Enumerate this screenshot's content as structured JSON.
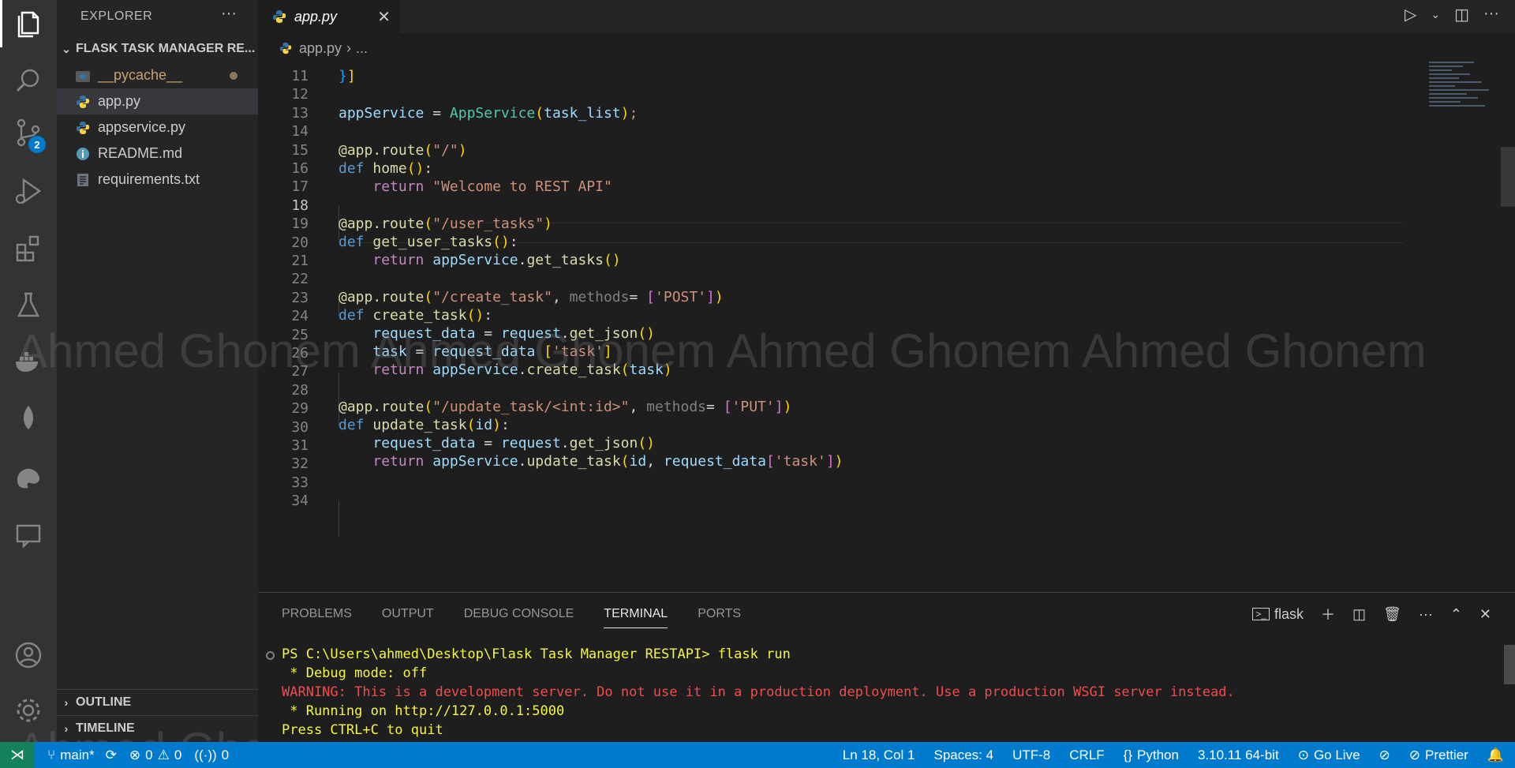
{
  "sidebar": {
    "title": "EXPLORER",
    "more": "···",
    "section": "FLASK TASK MANAGER RE...",
    "files": [
      {
        "name": "__pycache__",
        "icon": "python-folder-icon"
      },
      {
        "name": "app.py",
        "icon": "python-icon"
      },
      {
        "name": "appservice.py",
        "icon": "python-icon"
      },
      {
        "name": "README.md",
        "icon": "info-icon"
      },
      {
        "name": "requirements.txt",
        "icon": "text-file-icon"
      }
    ],
    "outline": "OUTLINE",
    "timeline": "TIMELINE"
  },
  "activity": {
    "scm_badge": "2"
  },
  "editor": {
    "tab_label": "app.py",
    "breadcrumb_file": "app.py",
    "breadcrumb_rest": "...",
    "line_numbers": [
      "11",
      "12",
      "13",
      "14",
      "15",
      "16",
      "17",
      "18",
      "19",
      "20",
      "21",
      "22",
      "23",
      "24",
      "25",
      "26",
      "27",
      "28",
      "29",
      "30",
      "31",
      "32",
      "33",
      "34"
    ]
  },
  "watermark": "Ahmed Ghonem   Ahmed Ghonem   Ahmed Ghonem   Ahmed Ghonem",
  "panel": {
    "tabs": [
      "PROBLEMS",
      "OUTPUT",
      "DEBUG CONSOLE",
      "TERMINAL",
      "PORTS"
    ],
    "terminal_name": "flask",
    "lines": {
      "prompt": "PS C:\\Users\\ahmed\\Desktop\\Flask Task Manager RESTAPI> ",
      "cmd": "flask run",
      "debug": " * Debug mode: off",
      "warning": "WARNING: This is a development server. Do not use it in a production deployment. Use a production WSGI server instead.",
      "running": " * Running on http://127.0.0.1:5000",
      "quit": "Press CTRL+C to quit"
    }
  },
  "status": {
    "branch": "main*",
    "errors": "0",
    "warnings": "0",
    "ports": "0",
    "position": "Ln 18, Col 1",
    "spaces": "Spaces: 4",
    "encoding": "UTF-8",
    "eol": "CRLF",
    "language": "Python",
    "interpreter": "3.10.11 64-bit",
    "golive": "Go Live",
    "prettier": "Prettier"
  }
}
